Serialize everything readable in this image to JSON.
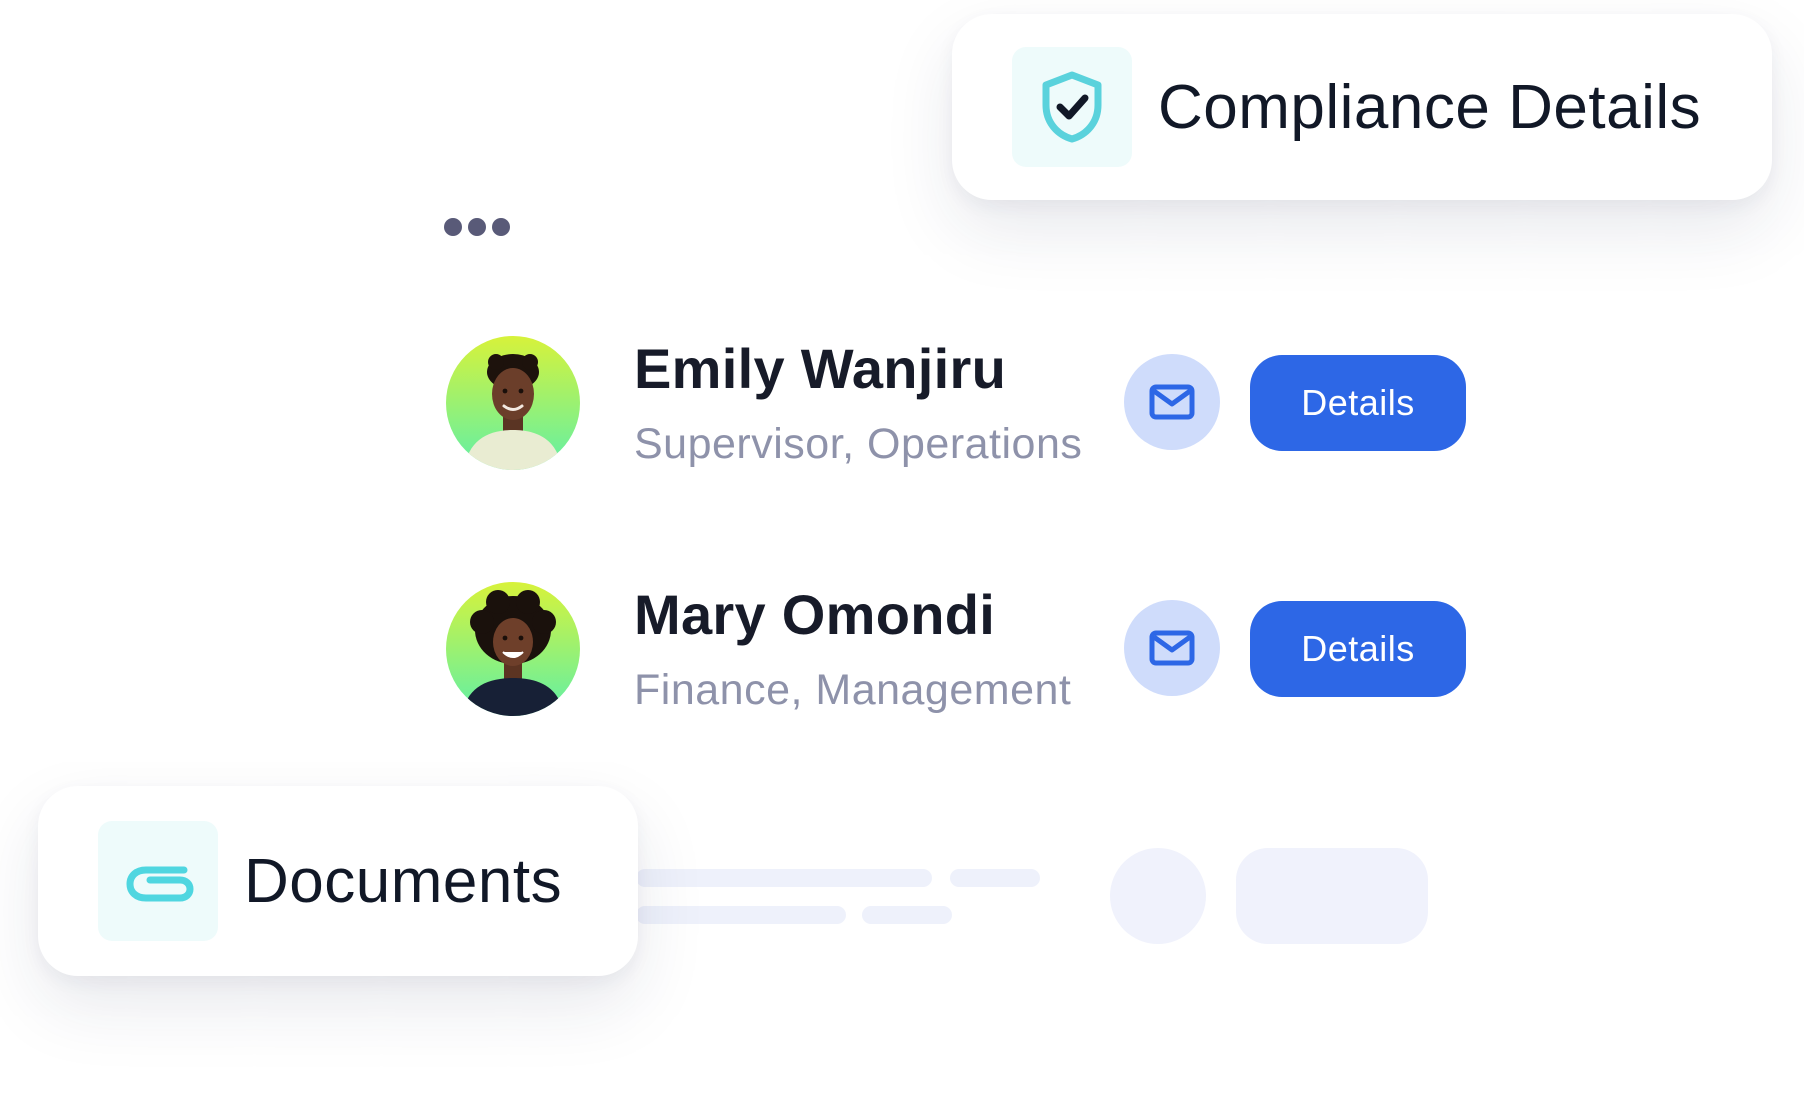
{
  "compliance_card": {
    "title": "Compliance Details",
    "icon": "shield-check-icon"
  },
  "documents_card": {
    "title": "Documents",
    "icon": "paperclip-icon"
  },
  "menu": {
    "icon": "more-horizontal-icon"
  },
  "people": [
    {
      "name": "Emily Wanjiru",
      "role": "Supervisor, Operations",
      "mail_icon": "mail-icon",
      "details_label": "Details"
    },
    {
      "name": "Mary Omondi",
      "role": "Finance, Management",
      "mail_icon": "mail-icon",
      "details_label": "Details"
    }
  ],
  "colors": {
    "accent": "#2d67e6",
    "mail_bg": "#cfdcfb",
    "icon_teal": "#4fd6e0",
    "role_text": "#8e92aa",
    "avatar_gradient_top": "#d7f23a",
    "avatar_gradient_bottom": "#5ff0a8"
  }
}
